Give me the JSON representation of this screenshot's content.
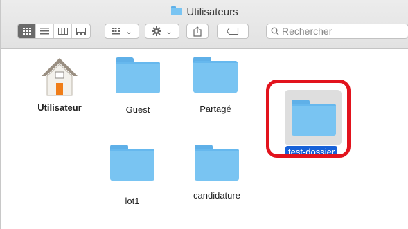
{
  "window": {
    "title": "Utilisateurs",
    "title_icon": "folder-icon"
  },
  "toolbar": {
    "view_modes": [
      "icon-view-icon",
      "list-view-icon",
      "column-view-icon",
      "gallery-view-icon"
    ],
    "group_icon": "group-by-icon",
    "action_icon": "gear-icon",
    "share_icon": "share-icon",
    "tag_icon": "tag-icon",
    "search_placeholder": "Rechercher"
  },
  "items": [
    {
      "label": "Utilisateur",
      "kind": "home"
    },
    {
      "label": "Guest",
      "kind": "folder"
    },
    {
      "label": "Partagé",
      "kind": "folder"
    },
    {
      "label": "test-dossier",
      "kind": "folder",
      "selected": true
    },
    {
      "label": "lot1",
      "kind": "folder"
    },
    {
      "label": "candidature",
      "kind": "folder"
    }
  ],
  "colors": {
    "folder": "#79c4f2",
    "selection": "#1761d8",
    "highlight": "#e2131d"
  }
}
